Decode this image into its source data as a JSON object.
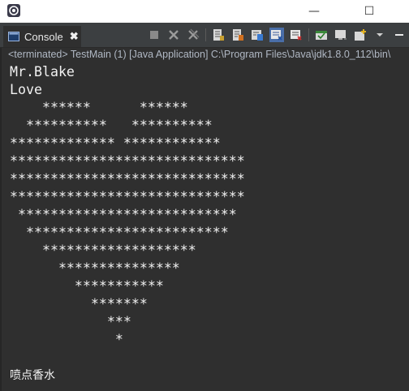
{
  "window": {
    "minimize_glyph": "—",
    "maximize_glyph": "☐"
  },
  "console_tab": {
    "label": "Console",
    "close_glyph": "✖"
  },
  "toolbar": {
    "icons": [
      "terminate-icon",
      "remove-launch-icon",
      "remove-all-terminated-icon",
      "scroll-lock-icon",
      "word-wrap-icon",
      "show-on-output-icon",
      "show-on-error-icon",
      "pin-console-icon",
      "display-selected-console-icon",
      "open-console-icon",
      "minimize-view-icon"
    ]
  },
  "console": {
    "status": "<terminated> TestMain (1) [Java Application] C:\\Program Files\\Java\\jdk1.8.0_112\\bin\\",
    "output_lines": [
      "Mr.Blake",
      "Love",
      "    ******      ******",
      "  **********   **********",
      "************* ************",
      "*****************************",
      "*****************************",
      "*****************************",
      " ***************************",
      "  *************************",
      "    *******************",
      "      ***************",
      "        ***********",
      "          *******",
      "            ***",
      "             *",
      "",
      "喷点香水"
    ]
  },
  "colors": {
    "background": "#2f2f2f",
    "text": "#f2f2f2",
    "status_text": "#b0b8c4",
    "toolbar_bg": "#3c3f41"
  }
}
